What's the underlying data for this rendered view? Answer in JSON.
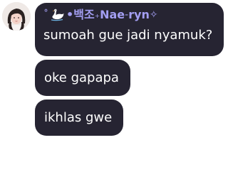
{
  "sender": {
    "name_prefix": "˚",
    "name_bullet": " • ",
    "name_korean": "백조",
    "name_sep1": " ₊ ",
    "name_main": "Nae",
    "name_sep2": " - ",
    "name_suffix": "ryn",
    "name_end": " ✧",
    "avatar_icon": "profile-photo",
    "name_color": "#a39ef2"
  },
  "messages": [
    {
      "text": "sumoah gue jadi nyamuk?"
    },
    {
      "text": "oke gapapa"
    },
    {
      "text": "ikhlas gwe"
    }
  ],
  "colors": {
    "bubble_bg": "#262432",
    "bubble_text": "#ffffff"
  }
}
